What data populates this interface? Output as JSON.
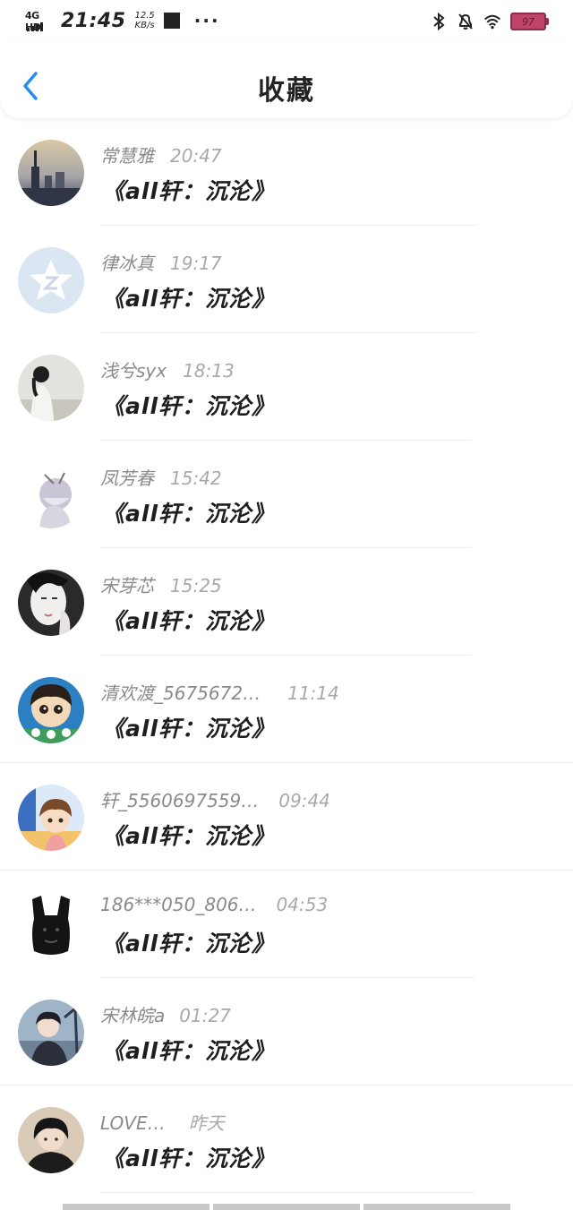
{
  "status_bar": {
    "network": "4G HD",
    "time": "21:45",
    "speed_value": "12.5",
    "speed_unit": "KB/s",
    "battery": "97",
    "icons": [
      "stop-icon",
      "more-icon",
      "bluetooth-icon",
      "mute-icon",
      "wifi-icon",
      "battery-icon"
    ]
  },
  "header": {
    "title": "收藏",
    "back_icon": "chevron-left-icon",
    "accent": "#2a8cf0"
  },
  "items": [
    {
      "name": "常慧雅",
      "time": "20:47",
      "title": "《all轩：沉沦》"
    },
    {
      "name": "律冰真",
      "time": "19:17",
      "title": "《all轩：沉沦》"
    },
    {
      "name": "浅兮syx",
      "time": "18:13",
      "title": "《all轩：沉沦》"
    },
    {
      "name": "凤芳春",
      "time": "15:42",
      "title": "《all轩：沉沦》"
    },
    {
      "name": "宋芽芯",
      "time": "15:25",
      "title": "《all轩：沉沦》"
    },
    {
      "name": "清欢渡_5675672…",
      "time": "11:14",
      "title": "《all轩：沉沦》"
    },
    {
      "name": "轩_5560697559…",
      "time": "09:44",
      "title": "《all轩：沉沦》"
    },
    {
      "name": "186***050_806…",
      "time": "04:53",
      "title": "《all轩：沉沦》"
    },
    {
      "name": "宋林皖a",
      "time": "01:27",
      "title": "《all轩：沉沦》"
    },
    {
      "name": "LOVE…",
      "time": "昨天",
      "title": "《all轩：沉沦》"
    }
  ]
}
